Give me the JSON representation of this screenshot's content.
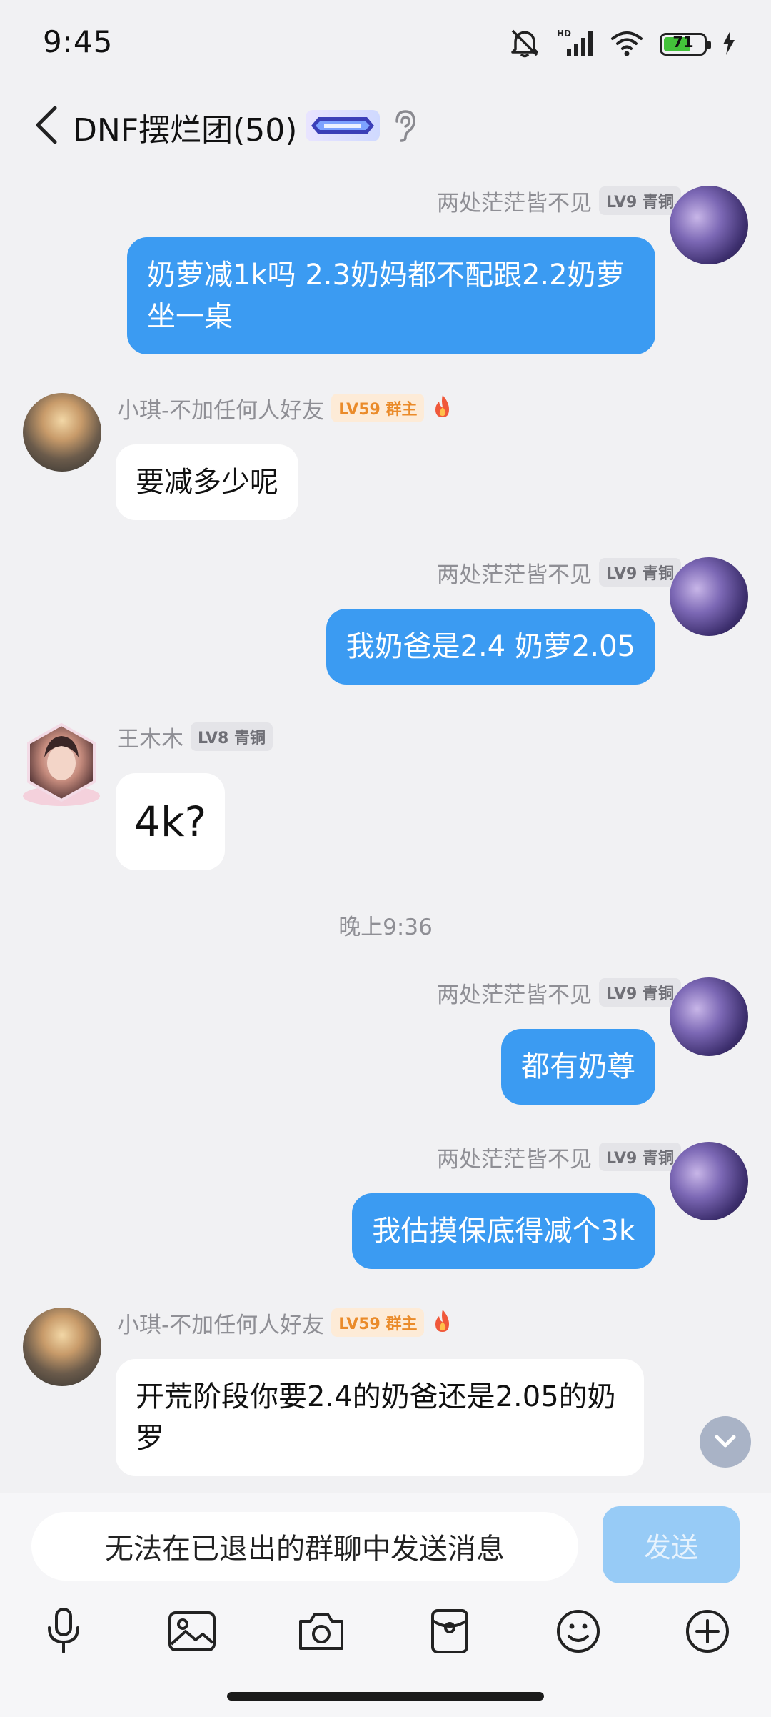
{
  "status": {
    "time": "9:45",
    "battery": "71",
    "battery_level": 0.71
  },
  "header": {
    "title": "DNF摆烂团(50)"
  },
  "messages": [
    {
      "side": "me",
      "sender": "两处茫茫皆不见",
      "level": "LV9 青铜",
      "text": "奶萝减1k吗 2.3奶妈都不配跟2.2奶萝坐一桌"
    },
    {
      "side": "other",
      "sender": "小琪-不加任何人好友",
      "level": "LV59 群主",
      "text": "要减多少呢"
    },
    {
      "side": "me",
      "sender": "两处茫茫皆不见",
      "level": "LV9 青铜",
      "text": "我奶爸是2.4 奶萝2.05"
    },
    {
      "side": "other",
      "sender": "王木木",
      "level": "LV8 青铜",
      "text": "4k?"
    },
    {
      "side": "me",
      "sender": "两处茫茫皆不见",
      "level": "LV9 青铜",
      "text": "都有奶尊"
    },
    {
      "side": "me",
      "sender": "两处茫茫皆不见",
      "level": "LV9 青铜",
      "text": "我估摸保底得减个3k"
    },
    {
      "side": "other",
      "sender": "小琪-不加任何人好友",
      "level": "LV59 群主",
      "text": "开荒阶段你要2.4的奶爸还是2.05的奶罗"
    }
  ],
  "time_divider": "晚上9:36",
  "input": {
    "placeholder": "无法在已退出的群聊中发送消息",
    "send_label": "发送"
  },
  "toolbar": [
    "microphone-icon",
    "image-icon",
    "camera-icon",
    "red-packet-icon",
    "emoji-icon",
    "plus-icon"
  ],
  "colors": {
    "my_bubble": "#3b9bf2",
    "other_bubble": "#ffffff",
    "background": "#f1f1f3",
    "owner_badge": "#ea8b2a"
  }
}
